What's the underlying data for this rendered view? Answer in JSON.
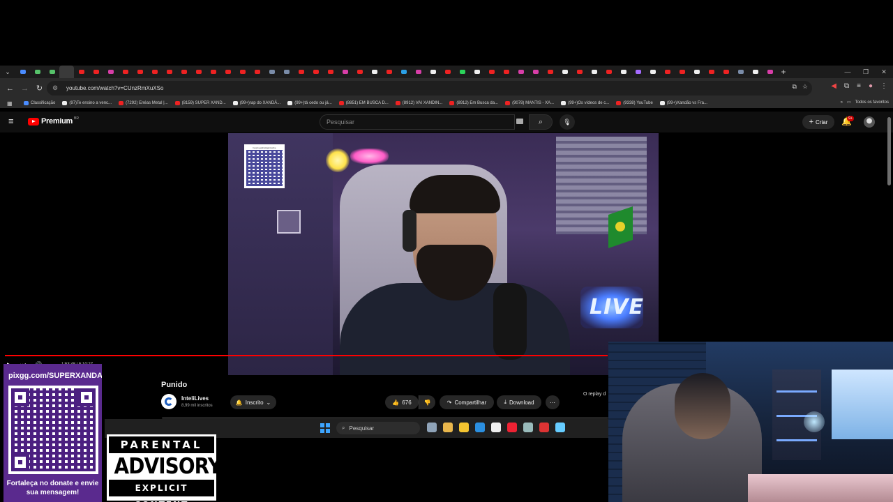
{
  "browser": {
    "url": "youtube.com/watch?v=CUnzRmXuXSo",
    "tab_colors": [
      "#4a8cff",
      "#56c26a",
      "#56c26a",
      "#3a3a3a",
      "#e22",
      "#e22",
      "#d83ea8",
      "#e22",
      "#e22",
      "#e22",
      "#e22",
      "#e22",
      "#e22",
      "#e22",
      "#e22",
      "#e22",
      "#e22",
      "#7a8ca8",
      "#7a8ca8",
      "#e22",
      "#e22",
      "#e22",
      "#d83ea8",
      "#e22",
      "#eee",
      "#e22",
      "#2ba0e6",
      "#d83ea8",
      "#eee",
      "#e22",
      "#2bd45a",
      "#eee",
      "#e22",
      "#e22",
      "#d83ea8",
      "#d83ea8",
      "#e22",
      "#eee",
      "#e22",
      "#eee",
      "#e22",
      "#eee",
      "#a56bff",
      "#eee",
      "#e22",
      "#e22",
      "#eee",
      "#e22",
      "#e22",
      "#7a8ca8",
      "#eee",
      "#d83ea8"
    ],
    "new_tab_label": "+",
    "bookmarks": [
      {
        "label": "Classificação",
        "color": "#4a8cff"
      },
      {
        "label": "(97)Te ensino a venc...",
        "color": "#eee"
      },
      {
        "label": "(7292) Enéas Metal |...",
        "color": "#e22"
      },
      {
        "label": "(8159) SUPER XAND...",
        "color": "#e22"
      },
      {
        "label": "(99+)rap do XANDÃ...",
        "color": "#eee"
      },
      {
        "label": "(99+)tá cedo ou já...",
        "color": "#eee"
      },
      {
        "label": "(8851) EM BUSCA D...",
        "color": "#e22"
      },
      {
        "label": "(8912) VAI XANDIN...",
        "color": "#e22"
      },
      {
        "label": "(8912) Em Busca da...",
        "color": "#e22"
      },
      {
        "label": "(9078) MANTIS - XA...",
        "color": "#e22"
      },
      {
        "label": "(99+)Os vídeos de c...",
        "color": "#eee"
      },
      {
        "label": "(9338) YouTube",
        "color": "#e22"
      },
      {
        "label": "(99+)Xandão vs Fra...",
        "color": "#eee"
      }
    ],
    "all_bookmarks": "Todos os favoritos"
  },
  "youtube": {
    "logo": "Premium",
    "region": "BR",
    "search_placeholder": "Pesquisar",
    "create_label": "Criar",
    "notification_badge": "9+",
    "accent": "#ff0000"
  },
  "player": {
    "timecode": "1:53:48 / 5:10:27",
    "progress_fraction": 1.0
  },
  "video": {
    "title": "Punido",
    "channel": "InteliLives",
    "subscribers": "8,99 mil inscritos",
    "subscribe_label": "Inscrito",
    "likes": "676",
    "share_label": "Compartilhar",
    "download_label": "Download",
    "replay_text": "O replay d",
    "qr_caption": "livepix.gg/inteliganteslive",
    "sign_text": "LIVE"
  },
  "taskbar": {
    "search_label": "Pesquisar",
    "app_colors": [
      "#8fa3b8",
      "#e8b64c",
      "#f4c430",
      "#2b8fe0",
      "#eee",
      "#e23",
      "#9bb",
      "#d33",
      "#6cf"
    ]
  },
  "overlay": {
    "pix_url": "pixgg.com/SUPERXANDAO",
    "pix_message": "Fortaleça no donate e envie sua mensagem!",
    "advisory_top": "PARENTAL",
    "advisory_mid": "ADVISORY",
    "advisory_bot": "EXPLICIT CONTENT",
    "panel_color": "#5a2a8e"
  }
}
